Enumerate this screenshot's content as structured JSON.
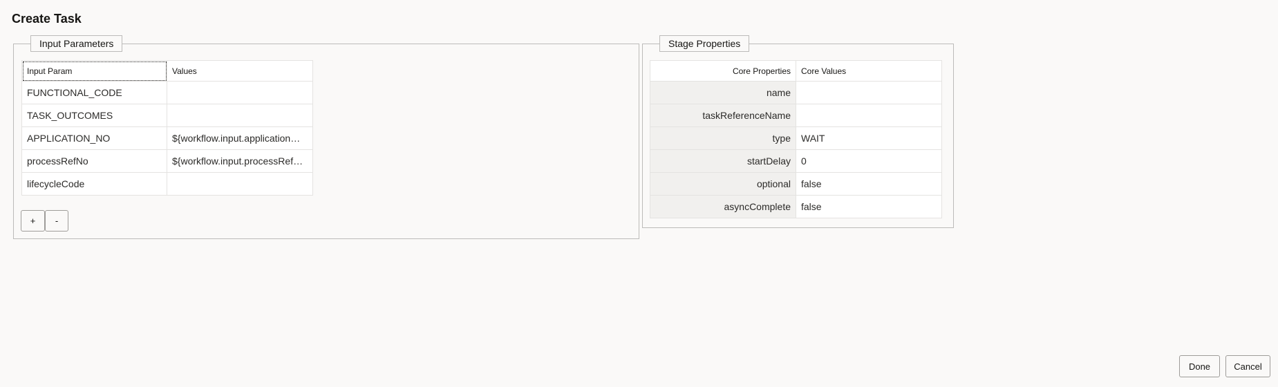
{
  "page": {
    "title": "Create Task"
  },
  "input_parameters": {
    "legend": "Input Parameters",
    "columns": [
      "Input Param",
      "Values"
    ],
    "rows": [
      {
        "param": "FUNCTIONAL_CODE",
        "value": ""
      },
      {
        "param": "TASK_OUTCOMES",
        "value": ""
      },
      {
        "param": "APPLICATION_NO",
        "value": "${workflow.input.application…"
      },
      {
        "param": "processRefNo",
        "value": "${workflow.input.processRef…"
      },
      {
        "param": "lifecycleCode",
        "value": ""
      }
    ],
    "add_label": "+",
    "remove_label": "-"
  },
  "stage_properties": {
    "legend": "Stage Properties",
    "columns": [
      "Core Properties",
      "Core Values"
    ],
    "rows": [
      {
        "prop": "name",
        "value": ""
      },
      {
        "prop": "taskReferenceName",
        "value": ""
      },
      {
        "prop": "type",
        "value": "WAIT"
      },
      {
        "prop": "startDelay",
        "value": "0"
      },
      {
        "prop": "optional",
        "value": "false"
      },
      {
        "prop": "asyncComplete",
        "value": "false"
      }
    ]
  },
  "footer": {
    "done_label": "Done",
    "cancel_label": "Cancel"
  }
}
